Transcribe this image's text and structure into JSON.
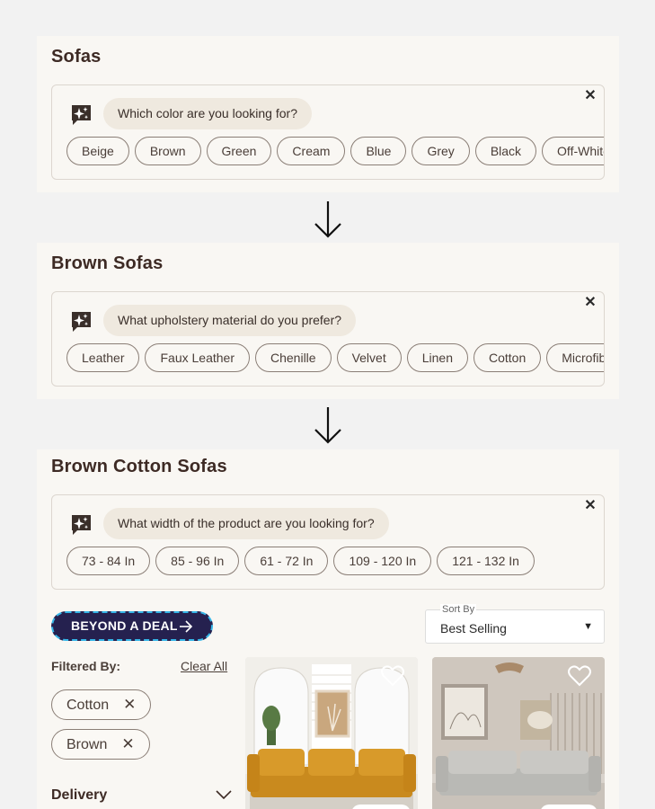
{
  "step1": {
    "title": "Sofas",
    "question": "Which color are you looking for?",
    "chips": [
      "Beige",
      "Brown",
      "Green",
      "Cream",
      "Blue",
      "Grey",
      "Black",
      "Off-White"
    ]
  },
  "step2": {
    "title": "Brown Sofas",
    "question": "What upholstery material do you prefer?",
    "chips": [
      "Leather",
      "Faux Leather",
      "Chenille",
      "Velvet",
      "Linen",
      "Cotton",
      "Microfiber"
    ]
  },
  "step3": {
    "title": "Brown Cotton Sofas",
    "question": "What width of the product are you looking for?",
    "chips": [
      "73 - 84 In",
      "85 - 96 In",
      "61 - 72 In",
      "109 - 120 In",
      "121 - 132 In"
    ]
  },
  "close_glyph": "✕",
  "deal_label": "BEYOND A DEAL",
  "sort": {
    "label": "Sort By",
    "value": "Best Selling"
  },
  "filters": {
    "heading": "Filtered By:",
    "clear_label": "Clear All",
    "applied": [
      "Cotton",
      "Brown"
    ],
    "remove_glyph": "✕"
  },
  "delivery_label": "Delivery",
  "colors": {
    "panel_bg": "#f9f7f3",
    "bubble_bg": "#efe9df",
    "deal_bg": "#25214f",
    "deal_border": "#35b6e8",
    "title": "#3d2a24"
  }
}
